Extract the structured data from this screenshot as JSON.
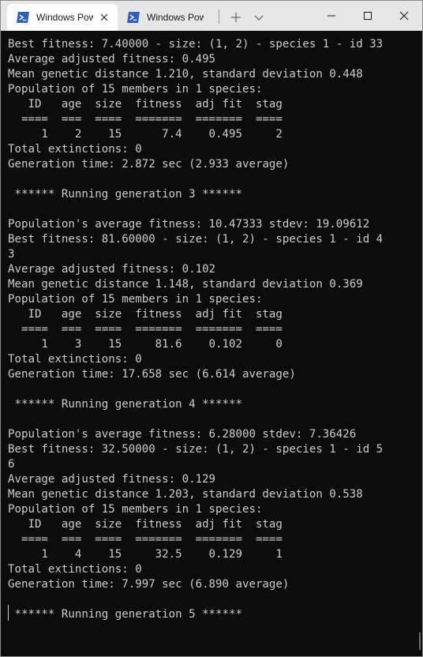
{
  "tabs": [
    {
      "label": "Windows PowerShell",
      "active": true
    },
    {
      "label": "Windows PowerShell",
      "active": false
    }
  ],
  "icons": {
    "tab_icon": "powershell-icon",
    "close": "close-icon",
    "new_tab": "plus-icon",
    "dropdown": "chevron-down-icon",
    "minimize": "minimize-icon",
    "maximize": "maximize-icon",
    "window_close": "window-close-icon"
  },
  "colors": {
    "terminal_bg": "#0c0c0c",
    "terminal_fg": "#cccccc",
    "titlebar_bg": "#e6e6e6",
    "tab_icon_bg": "#2c5fc8"
  },
  "terminal": {
    "lines": [
      "Best fitness: 7.40000 - size: (1, 2) - species 1 - id 33",
      "Average adjusted fitness: 0.495",
      "Mean genetic distance 1.210, standard deviation 0.448",
      "Population of 15 members in 1 species:",
      "   ID   age  size  fitness  adj fit  stag",
      "  ====  ===  ====  =======  =======  ====",
      "     1    2    15      7.4    0.495     2",
      "Total extinctions: 0",
      "Generation time: 2.872 sec (2.933 average)",
      "",
      " ****** Running generation 3 ******",
      "",
      "Population's average fitness: 10.47333 stdev: 19.09612",
      "Best fitness: 81.60000 - size: (1, 2) - species 1 - id 4",
      "3",
      "Average adjusted fitness: 0.102",
      "Mean genetic distance 1.148, standard deviation 0.369",
      "Population of 15 members in 1 species:",
      "   ID   age  size  fitness  adj fit  stag",
      "  ====  ===  ====  =======  =======  ====",
      "     1    3    15     81.6    0.102     0",
      "Total extinctions: 0",
      "Generation time: 17.658 sec (6.614 average)",
      "",
      " ****** Running generation 4 ******",
      "",
      "Population's average fitness: 6.28000 stdev: 7.36426",
      "Best fitness: 32.50000 - size: (1, 2) - species 1 - id 5",
      "6",
      "Average adjusted fitness: 0.129",
      "Mean genetic distance 1.203, standard deviation 0.538",
      "Population of 15 members in 1 species:",
      "   ID   age  size  fitness  adj fit  stag",
      "  ====  ===  ====  =======  =======  ====",
      "     1    4    15     32.5    0.129     1",
      "Total extinctions: 0",
      "Generation time: 7.997 sec (6.890 average)",
      "",
      " ****** Running generation 5 ******",
      ""
    ]
  }
}
